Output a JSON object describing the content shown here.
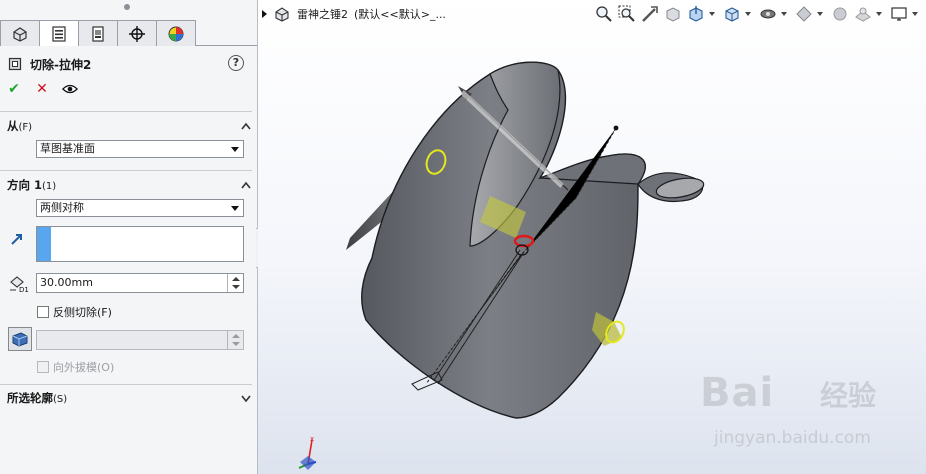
{
  "panel": {
    "tabs": [
      {
        "icon": "feature-manager-icon"
      },
      {
        "icon": "property-manager-icon",
        "active": true
      },
      {
        "icon": "configuration-manager-icon"
      },
      {
        "icon": "dim-xpert-icon"
      },
      {
        "icon": "display-manager-icon"
      }
    ],
    "feature_title": "切除-拉伸2",
    "help_label": "?",
    "ok_label": "✔",
    "cancel_label": "✕",
    "from": {
      "heading": "从",
      "heading_suffix": "(F)",
      "selected": "草图基准面"
    },
    "direction1": {
      "heading": "方向 1",
      "heading_suffix": "(1)",
      "end_condition": "两侧对称",
      "depth_value": "30.00mm",
      "flip_label": "反侧切除(F)",
      "draft_value": "",
      "draft_outward_label": "向外拔模(O)"
    },
    "selected_contours": {
      "heading": "所选轮廓",
      "heading_suffix": "(S)"
    }
  },
  "viewport": {
    "document_name": "雷神之锤2",
    "config_text": "(默认<<默认>_...",
    "toolbar_icons": [
      "zoom-to-fit-icon",
      "zoom-to-area-icon",
      "previous-view-icon",
      "section-view-icon",
      "dynamic-annotation-icon",
      "view-orientation-icon",
      "display-style-icon",
      "hide-show-items-icon",
      "edit-appearance-icon",
      "apply-scene-icon",
      "view-settings-icon"
    ],
    "watermark_brand": "Bai",
    "watermark_cn": "经验",
    "watermark_url": "jingyan.baidu.com"
  },
  "colors": {
    "model_surface": "#7b7e84",
    "model_dark": "#4d5056",
    "highlight_yellow": "#e4e81c",
    "selection_blue": "#5aa6ee"
  }
}
